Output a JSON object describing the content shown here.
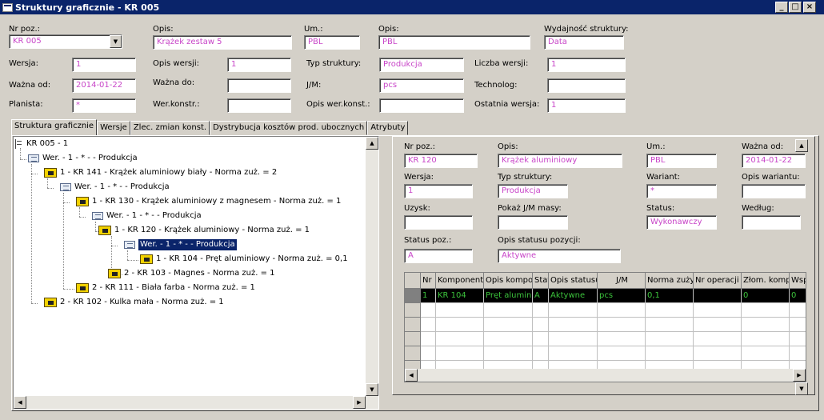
{
  "window": {
    "title": "Struktury graficznie - KR 005"
  },
  "header": {
    "nr_poz_label": "Nr poz.:",
    "nr_poz_value": "KR 005",
    "opis1_label": "Opis:",
    "opis1_value": "Krążek zestaw 5",
    "um_label": "Um.:",
    "um_value": "PBL",
    "opis2_label": "Opis:",
    "opis2_value": "PBL",
    "wydajnosc_label": "Wydajność struktury:",
    "wydajnosc_value": "Data",
    "wersja_label": "Wersja:",
    "wersja_value": "1",
    "opis_wersji_label": "Opis wersji:",
    "opis_wersji_value": "1",
    "typ_label": "Typ struktury:",
    "typ_value": "Produkcja",
    "liczba_label": "Liczba wersji:",
    "liczba_value": "1",
    "wazna_od_label": "Ważna od:",
    "wazna_od_value": "2014-01-22",
    "wazna_do_label": "Ważna do:",
    "wazna_do_value": "",
    "jm_label": "J/M:",
    "jm_value": "pcs",
    "technolog_label": "Technolog:",
    "technolog_value": "",
    "planista_label": "Planista:",
    "planista_value": "*",
    "wer_konstr_label": "Wer.konstr.:",
    "wer_konstr_value": "",
    "opis_wer_konstr_label": "Opis wer.konst.:",
    "opis_wer_konstr_value": "",
    "ostatnia_label": "Ostatnia wersja:",
    "ostatnia_value": "1"
  },
  "tabs": [
    "Struktura graficznie",
    "Wersje",
    "Zlec. zmian konst.",
    "Dystrybucja kosztów prod. ubocznych",
    "Atrybuty"
  ],
  "tree": [
    "KR 005 - 1",
    "Wer. - 1 - * -  - Produkcja",
    "1 - KR 141 - Krążek aluminiowy biały - Norma zuż. = 2",
    "Wer. - 1 - * -  - Produkcja",
    "1 - KR 130 - Krążek aluminiowy z magnesem - Norma zuż. = 1",
    "Wer. - 1 - * -  - Produkcja",
    "1 - KR 120 - Krążek aluminiowy - Norma zuż. = 1",
    "Wer. - 1 - * -  - Produkcja",
    "1 - KR 104 - Pręt aluminiowy - Norma zuż. = 0,1",
    "2 - KR 103 - Magnes - Norma zuż. = 1",
    "2 - KR 111 - Biała farba - Norma zuż. = 1",
    "2 - KR 102 - Kulka mała - Norma zuż. = 1"
  ],
  "detail": {
    "nr_poz_label": "Nr poz.:",
    "nr_poz_value": "KR 120",
    "opis_label": "Opis:",
    "opis_value": "Krążek aluminiowy",
    "um_label": "Um.:",
    "um_value": "PBL",
    "wazna_od_label": "Ważna od:",
    "wazna_od_value": "2014-01-22",
    "wersja_label": "Wersja:",
    "wersja_value": "1",
    "typ_label": "Typ struktury:",
    "typ_value": "Produkcja",
    "wariant_label": "Wariant:",
    "wariant_value": "*",
    "opis_wariantu_label": "Opis wariantu:",
    "opis_wariantu_value": "",
    "uzysk_label": "Uzysk:",
    "uzysk_value": "",
    "pokaz_label": "Pokaż J/M masy:",
    "pokaz_value": "",
    "status_label": "Status:",
    "status_value": "Wykonawczy",
    "wedlug_label": "Według:",
    "wedlug_value": "",
    "status_poz_label": "Status poz.:",
    "status_poz_value": "A",
    "opis_statusu_label": "Opis statusu pozycji:",
    "opis_statusu_value": "Aktywne"
  },
  "grid": {
    "columns": [
      "Nr",
      "Komponent",
      "Opis kompo",
      "Stat",
      "Opis statusu",
      "J/M",
      "Norma zuży",
      "Nr operacji",
      "Złom. kompo",
      "Wsp"
    ],
    "rows": [
      [
        "1",
        "KR 104",
        "Pręt alumini",
        "A",
        "Aktywne",
        "pcs",
        "0,1",
        "",
        "0",
        "0"
      ]
    ]
  }
}
